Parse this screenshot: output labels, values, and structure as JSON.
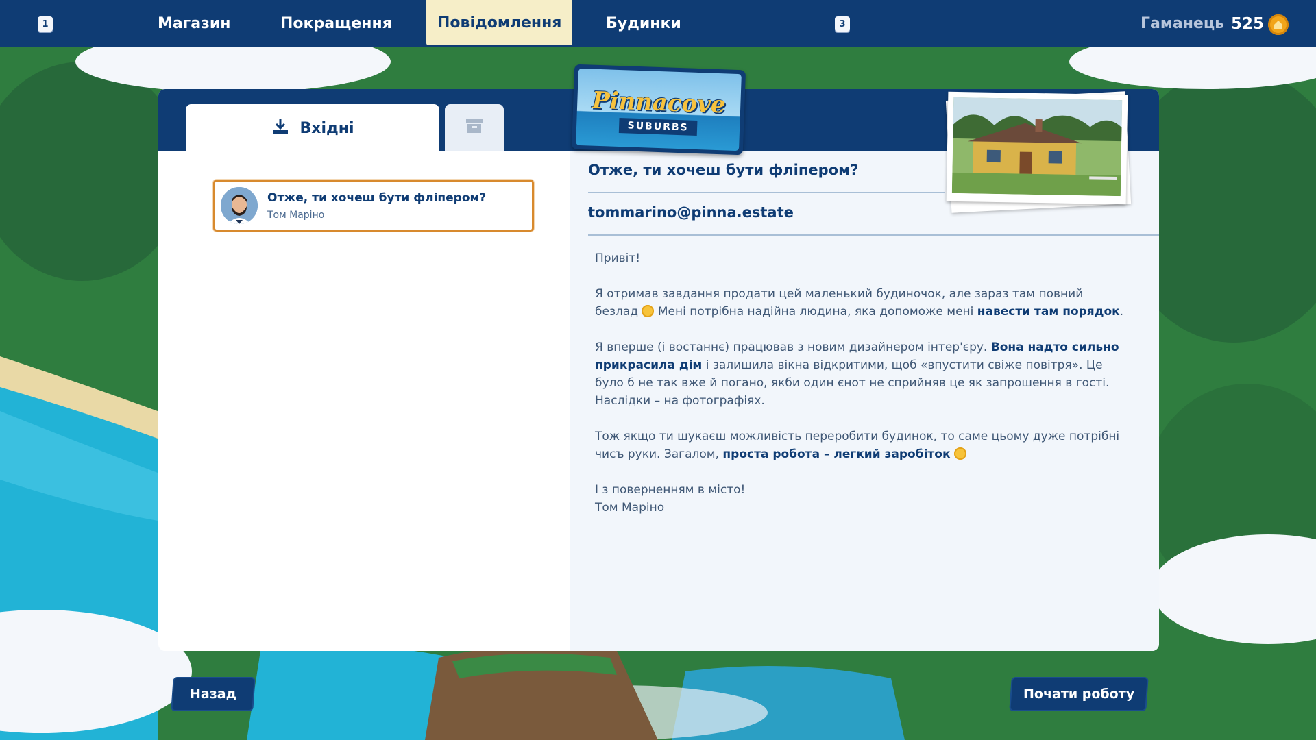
{
  "topbar": {
    "left_key": "1",
    "right_key": "3",
    "nav": [
      "Магазин",
      "Покращення",
      "Повідомлення",
      "Будинки"
    ],
    "active_nav": "Повідомлення",
    "wallet_label": "Гаманець",
    "wallet_amount": "525"
  },
  "tabs": {
    "inbox_label": "Вхідні"
  },
  "logo": {
    "title": "Pinnacove",
    "subtitle": "SUBURBS"
  },
  "messages": [
    {
      "subject": "Отже, ти хочеш бути фліпером?",
      "sender": "Том Маріно"
    }
  ],
  "mail": {
    "subject": "Отже, ти хочеш бути фліпером?",
    "from": "tommarino@pinna.estate",
    "greeting": "Привіт!",
    "p1_a": "Я отримав завдання продати цей маленький будиночок, але зараз там повний безлад",
    "p1_b": " Мені потрібна надійна людина, яка допоможе мені ",
    "p1_bold": "навести там порядок",
    "p1_end": ".",
    "p2_a": "Я вперше (і востаннє) працював з новим дизайнером інтер'єру. ",
    "p2_bold": "Вона надто сильно прикрасила дім",
    "p2_b": " і залишила вікна відкритими, щоб «впустити свіже повітря». Це було б не так вже й погано, якби один єнот не сприйняв це як запрошення в гості. Наслідки – на фотографіях.",
    "p3_a": "Тож якщо ти шукаєш можливість переробити будинок, то саме цьому дуже потрібні чисъ руки. Загалом, ",
    "p3_bold": "проста робота – легкий заробіток",
    "closing": "І з поверненням в місто!",
    "signature": "Том Маріно"
  },
  "buttons": {
    "back": "Назад",
    "start": "Почати роботу"
  },
  "colors": {
    "navy": "#0f3c74",
    "accent_border": "#d88a2e",
    "active_tab": "#f6eec8",
    "coin": "#f2a51a"
  },
  "icons": [
    "download-icon",
    "archive-icon",
    "coin-icon"
  ]
}
